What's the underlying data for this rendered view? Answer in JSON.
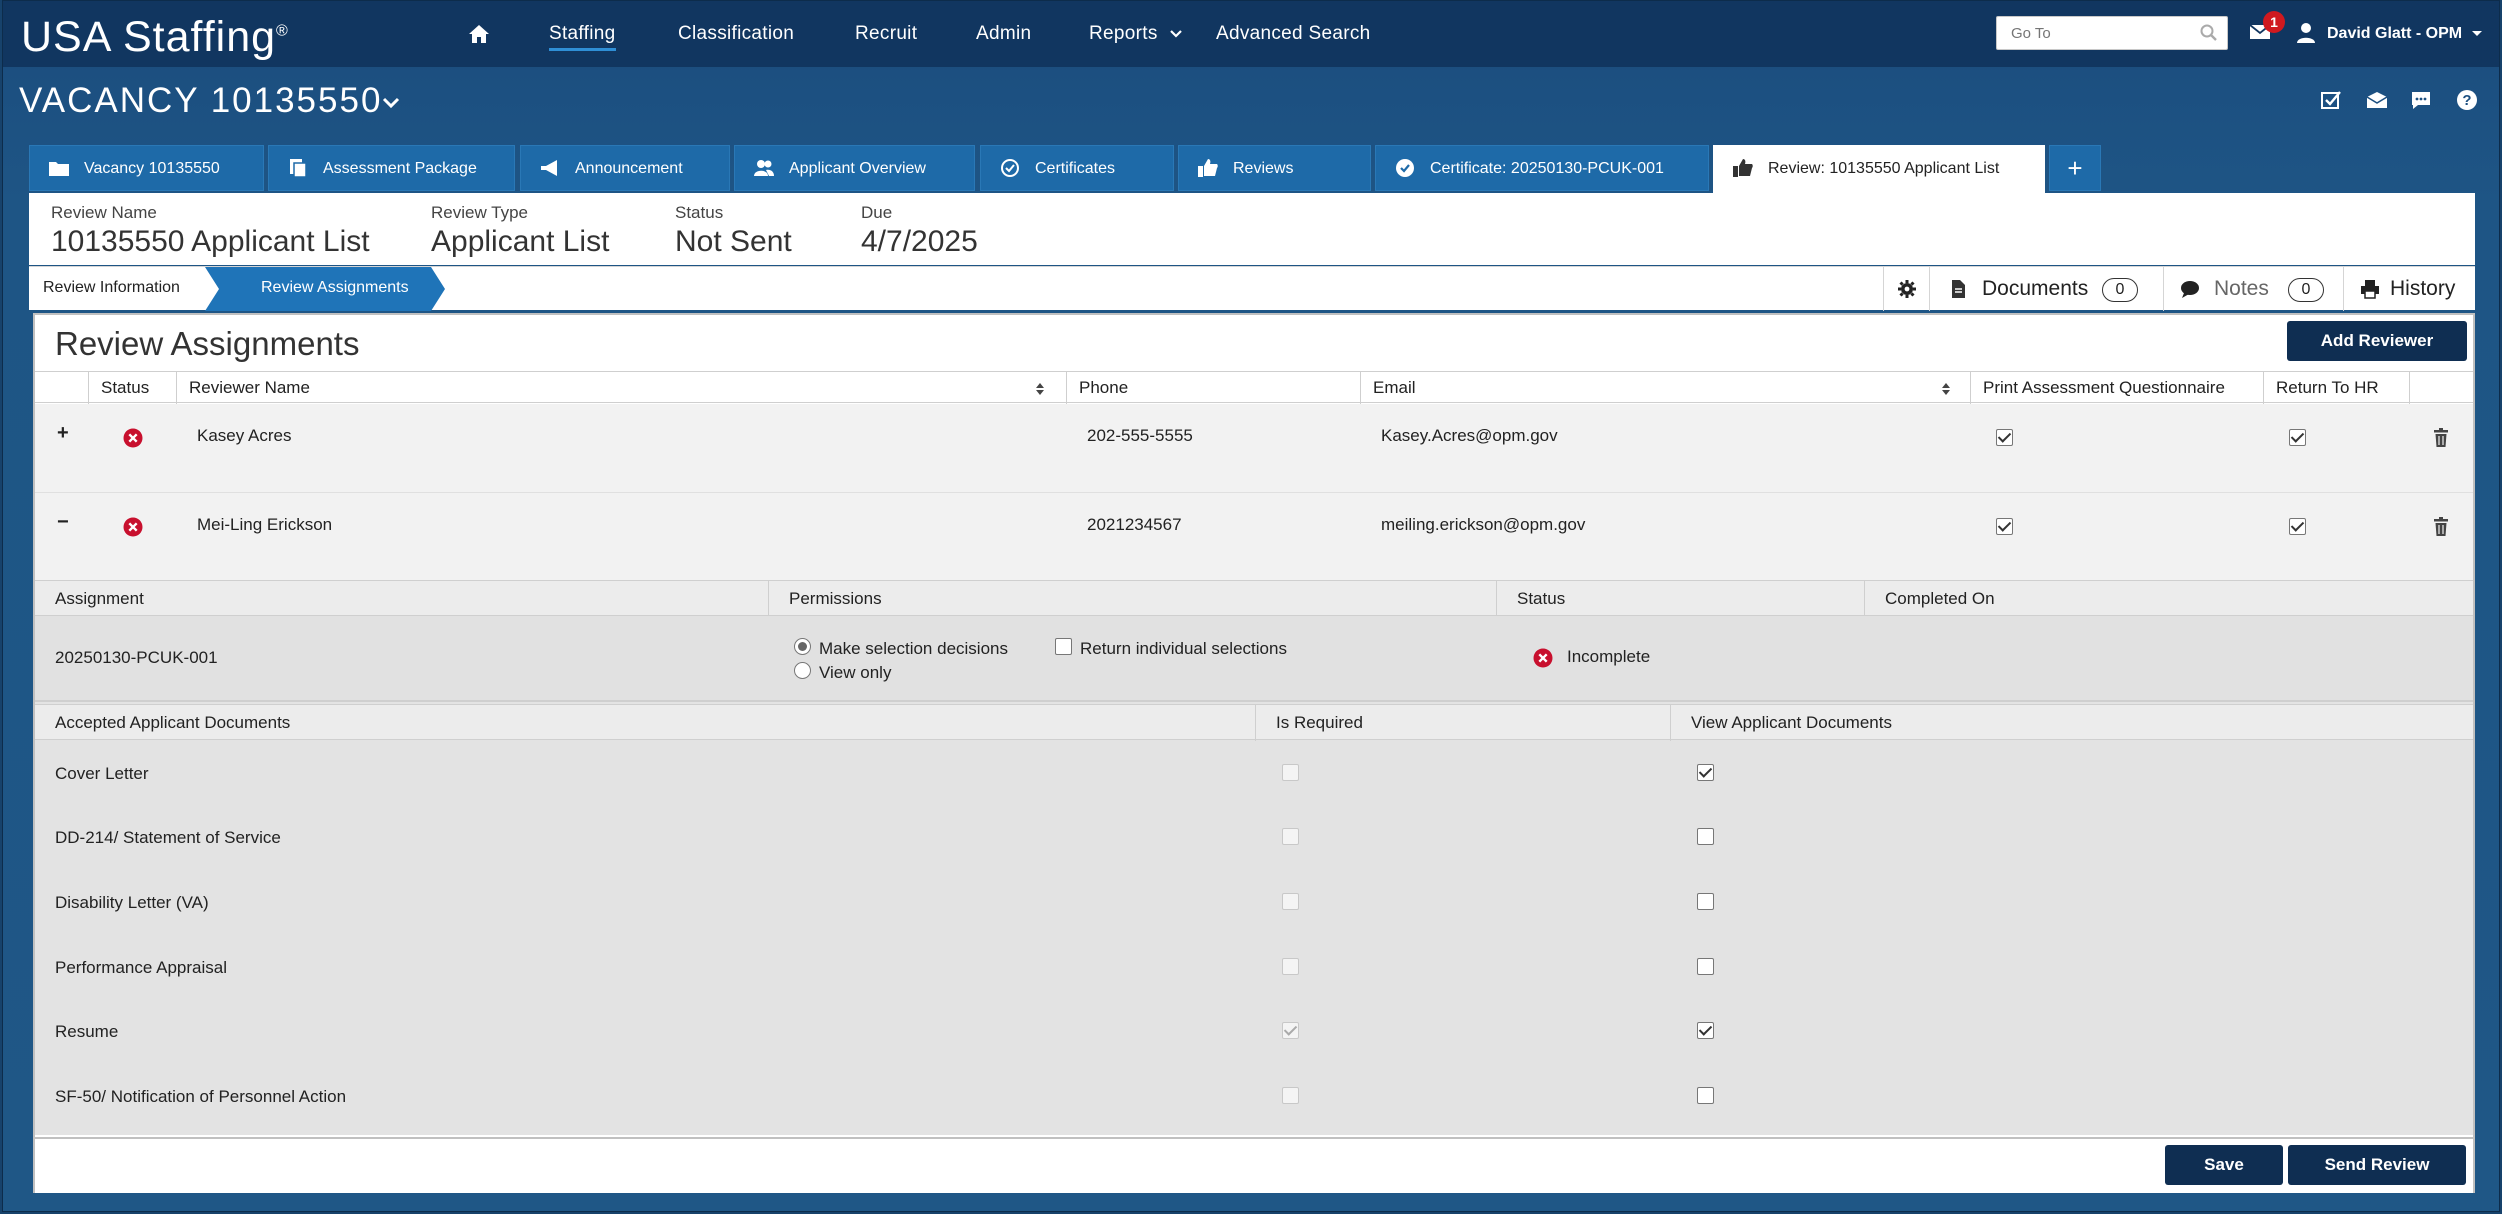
{
  "app": {
    "logo": "USA Staffing",
    "logo_mark": "®",
    "nav": [
      "Staffing",
      "Classification",
      "Recruit",
      "Admin",
      "Reports",
      "Advanced Search"
    ],
    "goto_placeholder": "Go To",
    "mail_count": "1",
    "user": "David Glatt - OPM"
  },
  "vacancy": {
    "title": "VACANCY 10135550"
  },
  "tabs": [
    {
      "label": "Vacancy 10135550",
      "icon": "folder-icon"
    },
    {
      "label": "Assessment Package",
      "icon": "documents-icon"
    },
    {
      "label": "Announcement",
      "icon": "megaphone-icon"
    },
    {
      "label": "Applicant Overview",
      "icon": "users-icon"
    },
    {
      "label": "Certificates",
      "icon": "check-circle-icon"
    },
    {
      "label": "Reviews",
      "icon": "thumbs-up-icon"
    },
    {
      "label": "Certificate: 20250130-PCUK-001",
      "icon": "check-circle-icon"
    },
    {
      "label": "Review: 10135550 Applicant List",
      "icon": "thumbs-up-icon"
    }
  ],
  "tab_add": "+",
  "summary": {
    "review_name_label": "Review Name",
    "review_name": "10135550 Applicant List",
    "review_type_label": "Review Type",
    "review_type": "Applicant List",
    "status_label": "Status",
    "status": "Not Sent",
    "due_label": "Due",
    "due": "4/7/2025"
  },
  "breadcrumbs": [
    "Review Information",
    "Review Assignments"
  ],
  "tools": {
    "documents_label": "Documents",
    "documents_count": "0",
    "notes_label": "Notes",
    "notes_count": "0",
    "history_label": "History"
  },
  "panel": {
    "title": "Review Assignments",
    "add_reviewer": "Add Reviewer",
    "columns": [
      "Status",
      "Reviewer Name",
      "Phone",
      "Email",
      "Print Assessment Questionnaire",
      "Return To HR"
    ],
    "reviewers": [
      {
        "expander": "+",
        "name": "Kasey Acres",
        "phone": "202-555-5555",
        "email": "Kasey.Acres@opm.gov",
        "print_aq": true,
        "return_hr": true
      },
      {
        "expander": "−",
        "name": "Mei-Ling Erickson",
        "phone": "2021234567",
        "email": "meiling.erickson@opm.gov",
        "print_aq": true,
        "return_hr": true
      }
    ],
    "assignment": {
      "columns": [
        "Assignment",
        "Permissions",
        "Status",
        "Completed On"
      ],
      "name": "20250130-PCUK-001",
      "perm_make": "Make selection decisions",
      "perm_view": "View only",
      "perm_return": "Return individual selections",
      "status": "Incomplete",
      "completed_on": ""
    },
    "documents": {
      "columns": [
        "Accepted Applicant Documents",
        "Is Required",
        "View Applicant Documents"
      ],
      "rows": [
        {
          "name": "Cover Letter",
          "required": false,
          "view": true
        },
        {
          "name": "DD-214/ Statement of Service",
          "required": false,
          "view": false
        },
        {
          "name": "Disability Letter (VA)",
          "required": false,
          "view": false
        },
        {
          "name": "Performance Appraisal",
          "required": false,
          "view": false
        },
        {
          "name": "Resume",
          "required": true,
          "view": true
        },
        {
          "name": "SF-50/ Notification of Personnel Action",
          "required": false,
          "view": false
        }
      ]
    },
    "save": "Save",
    "send_review": "Send Review"
  },
  "colors": {
    "nav_bg": "#113660",
    "tab_bg": "#1e6aa8",
    "button_dark": "#0f2e52",
    "status_error": "#c8102e"
  }
}
